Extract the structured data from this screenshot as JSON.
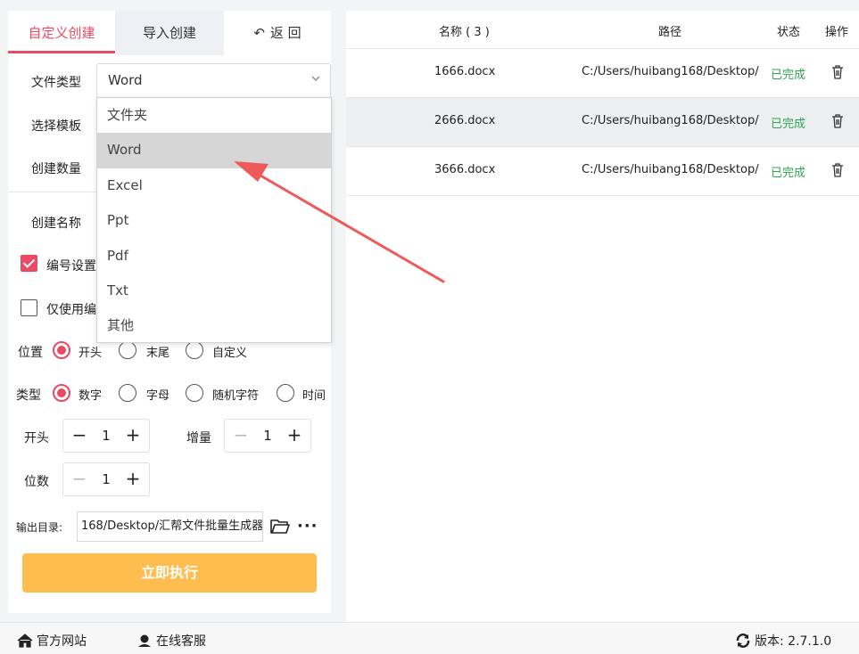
{
  "tabs": {
    "custom": "自定义创建",
    "import": "导入创建",
    "back": "返 回"
  },
  "form": {
    "file_type_label": "文件类型",
    "file_type_value": "Word",
    "template_label": "选择模板",
    "count_label": "创建数量",
    "name_label": "创建名称",
    "numbering_label": "编号设置",
    "numbering_checked": true,
    "only_number_label": "仅使用编",
    "only_number_checked": false,
    "position_label": "位置",
    "position_options": [
      "开头",
      "末尾",
      "自定义"
    ],
    "position_selected": "开头",
    "type_label": "类型",
    "type_options": [
      "数字",
      "字母",
      "随机字符",
      "时间"
    ],
    "type_selected": "数字",
    "start_label": "开头",
    "start_value": "1",
    "increment_label": "增量",
    "increment_value": "1",
    "digits_label": "位数",
    "digits_value": "1",
    "output_label": "输出目录:",
    "output_value": "168/Desktop/汇帮文件批量生成器",
    "run_button": "立即执行"
  },
  "dropdown": {
    "options": [
      "文件夹",
      "Word",
      "Excel",
      "Ppt",
      "Pdf",
      "Txt",
      "其他"
    ],
    "selected": "Word"
  },
  "table": {
    "headers": {
      "name": "名称 ( 3 )",
      "path": "路径",
      "status": "状态",
      "action": "操作"
    },
    "rows": [
      {
        "name": "1666.docx",
        "path": "C:/Users/huibang168/Desktop/",
        "status": "已完成"
      },
      {
        "name": "2666.docx",
        "path": "C:/Users/huibang168/Desktop/",
        "status": "已完成"
      },
      {
        "name": "3666.docx",
        "path": "C:/Users/huibang168/Desktop/",
        "status": "已完成"
      }
    ]
  },
  "footer": {
    "website": "官方网站",
    "support": "在线客服",
    "version": "版本: 2.7.1.0"
  },
  "colors": {
    "accent": "#ea4a64",
    "run_button": "#ffbd4f",
    "status_done": "#2ea44f",
    "arrow": "#ee5a5a"
  },
  "icons": [
    "back-icon",
    "chevron-down-icon",
    "folder-open-icon",
    "more-icon",
    "trash-icon",
    "home-icon",
    "support-icon",
    "refresh-icon"
  ]
}
